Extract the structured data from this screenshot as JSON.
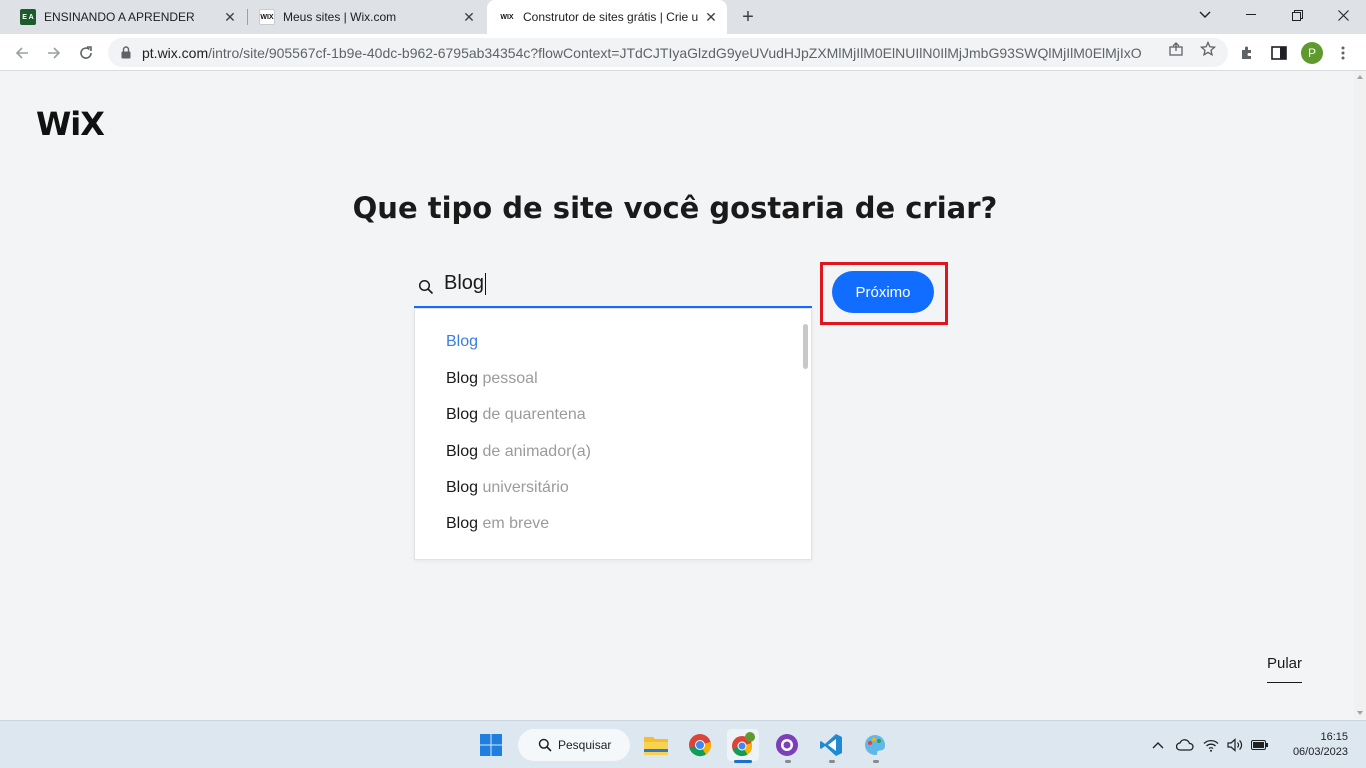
{
  "browser": {
    "tabs": [
      {
        "title": "ENSINANDO A APRENDER",
        "favicon": "ea-favicon",
        "active": false
      },
      {
        "title": "Meus sites | Wix.com",
        "favicon": "wix-favicon",
        "active": false
      },
      {
        "title": "Construtor de sites grátis | Crie u",
        "favicon": "wix-favicon",
        "active": true
      }
    ],
    "favicon_text": {
      "ea": "E A",
      "wix": "WIX"
    },
    "new_tab_label": "+",
    "url_host": "pt.wix.com",
    "url_path": "/intro/site/905567cf-1b9e-40dc-b962-6795ab34354c?flowContext=JTdCJTIyaGlzdG9yeUVudHJpZXMlMjIlM0ElNUIlN0IlMjJmbG93SWQlMjIlM0ElMjIxOW...",
    "profile_initial": "P",
    "close_glyph": "✕"
  },
  "page": {
    "logo": "WiX",
    "heading": "Que tipo de site você gostaria de criar?",
    "search": {
      "value": "Blog"
    },
    "suggestions": [
      {
        "prefix": "Blog",
        "rest": ""
      },
      {
        "prefix": "Blog",
        "rest": " pessoal"
      },
      {
        "prefix": "Blog",
        "rest": " de quarentena"
      },
      {
        "prefix": "Blog",
        "rest": " de animador(a)"
      },
      {
        "prefix": "Blog",
        "rest": " universitário"
      },
      {
        "prefix": "Blog",
        "rest": " em breve"
      }
    ],
    "next_button": "Próximo",
    "skip_link": "Pular"
  },
  "taskbar": {
    "search_label": "Pesquisar",
    "time": "16:15",
    "date": "06/03/2023",
    "accent": "#116dff",
    "highlight": "#e0161f"
  }
}
